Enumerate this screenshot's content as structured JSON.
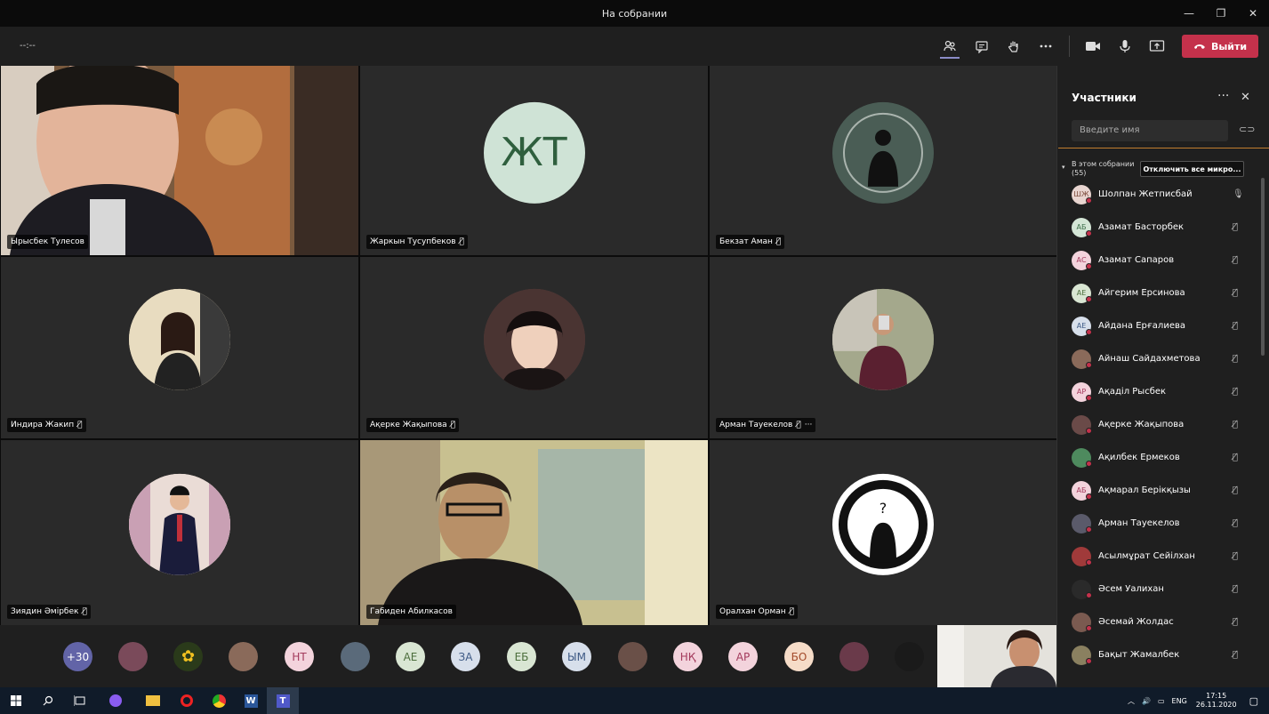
{
  "window": {
    "title": "На собрании",
    "min": "—",
    "restore": "❐",
    "close": "✕"
  },
  "toolbar": {
    "timer": "--:--",
    "leave_label": "Выйти"
  },
  "tiles": [
    {
      "name": "Ырысбек Тулесов",
      "muted": false
    },
    {
      "name": "Жаркын Тусупбеков",
      "muted": true,
      "initials": "ЖТ"
    },
    {
      "name": "Бекзат Аман",
      "muted": true
    },
    {
      "name": "Индира Жакип",
      "muted": true
    },
    {
      "name": "Ақерке Жақыпова",
      "muted": true
    },
    {
      "name": "Арман Тауекелов",
      "muted": true,
      "more": "···"
    },
    {
      "name": "Зиядин Әмірбек",
      "muted": true
    },
    {
      "name": "Габиден Абилкасов",
      "muted": false
    },
    {
      "name": "Оралхан Орман",
      "muted": true
    }
  ],
  "strip": [
    "+30",
    "",
    "",
    "",
    "НТ",
    "",
    "АЕ",
    "ЗА",
    "ЕБ",
    "ЫМ",
    "",
    "НҚ",
    "АР",
    "БО",
    "",
    ""
  ],
  "panel": {
    "title": "Участники",
    "more": "···",
    "close": "✕",
    "search_placeholder": "Введите имя",
    "section_line1": "В этом собрании",
    "section_line2": "(55)",
    "mute_all": "Отключить все микро...",
    "participants": [
      {
        "initials": "ШЖ",
        "name": "Шолпан Жетписбай",
        "color": "#e8d5d0",
        "fg": "#7a4a3a"
      },
      {
        "initials": "АБ",
        "name": "Азамат Басторбек",
        "color": "#d4e6d6",
        "fg": "#3b6e48"
      },
      {
        "initials": "АС",
        "name": "Азамат Сапаров",
        "color": "#f3d3dc",
        "fg": "#a33a5c"
      },
      {
        "initials": "АЕ",
        "name": "Айгерим Ерсинова",
        "color": "#d9e6d3",
        "fg": "#4c6e3c"
      },
      {
        "initials": "АЕ",
        "name": "Айдана Ерғалиева",
        "color": "#d7dfeb",
        "fg": "#3e5a85"
      },
      {
        "initials": "",
        "name": "Айнаш Сайдахметова",
        "color": "#8a6a5a",
        "fg": "#fff"
      },
      {
        "initials": "АР",
        "name": "Ақаділ Рысбек",
        "color": "#f3d3dc",
        "fg": "#a33a5c"
      },
      {
        "initials": "",
        "name": "Ақерке Жақыпова",
        "color": "#6a4a48",
        "fg": "#fff"
      },
      {
        "initials": "",
        "name": "Ақилбек Ермеков",
        "color": "#4e8a5e",
        "fg": "#fff"
      },
      {
        "initials": "АБ",
        "name": "Ақмарал Берікқызы",
        "color": "#f3d3dc",
        "fg": "#a33a5c"
      },
      {
        "initials": "",
        "name": "Арман Тауекелов",
        "color": "#5a5a6a",
        "fg": "#fff"
      },
      {
        "initials": "",
        "name": "Асылмұрат Сейілхан",
        "color": "#a03a3a",
        "fg": "#fff"
      },
      {
        "initials": "",
        "name": "Әсем Уалихан",
        "color": "#2a2a2a",
        "fg": "#fff"
      },
      {
        "initials": "",
        "name": "Әсемай Жолдас",
        "color": "#7a5a50",
        "fg": "#fff"
      },
      {
        "initials": "",
        "name": "Бақыт Жамалбек",
        "color": "#8a8060",
        "fg": "#fff"
      }
    ]
  },
  "taskbar": {
    "lang": "ENG",
    "time": "17:15",
    "date": "26.11.2020"
  }
}
